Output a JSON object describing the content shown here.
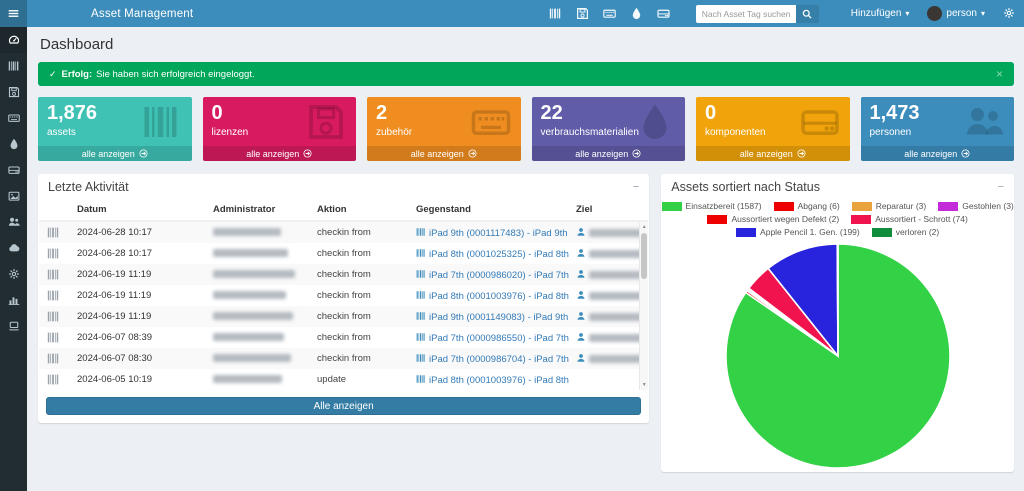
{
  "navbar": {
    "title": "Asset Management",
    "search_placeholder": "Nach Asset Tag suchen",
    "add_label": "Hinzufügen",
    "user_label": "person",
    "color": "#3c8dbc",
    "shortcut_icons": [
      "barcode-icon",
      "floppy-icon",
      "keyboard-icon",
      "droplet-icon",
      "hdd-icon"
    ]
  },
  "sidebar": {
    "color": "#222d32",
    "items": [
      {
        "name": "dashboard",
        "icon": "tachometer-icon",
        "active": true
      },
      {
        "name": "assets",
        "icon": "barcode-icon",
        "active": false
      },
      {
        "name": "licenses",
        "icon": "floppy-icon",
        "active": false
      },
      {
        "name": "accessories",
        "icon": "keyboard-icon",
        "active": false
      },
      {
        "name": "consumables",
        "icon": "droplet-icon",
        "active": false
      },
      {
        "name": "components",
        "icon": "hdd-icon",
        "active": false
      },
      {
        "name": "kits",
        "icon": "image-icon",
        "active": false
      },
      {
        "name": "people",
        "icon": "users-icon",
        "active": false
      },
      {
        "name": "import",
        "icon": "cloud-icon",
        "active": false
      },
      {
        "name": "settings",
        "icon": "gear-icon",
        "active": false
      },
      {
        "name": "reports",
        "icon": "bar-chart-icon",
        "active": false
      },
      {
        "name": "requestable",
        "icon": "laptop-icon",
        "active": false
      }
    ]
  },
  "page": {
    "title": "Dashboard"
  },
  "alert": {
    "prefix": "Erfolg:",
    "message": "Sie haben sich erfolgreich eingeloggt.",
    "color": "#00a65a"
  },
  "cards": [
    {
      "count": "1,876",
      "label": "assets",
      "color": "#3fc1b4",
      "icon": "barcode-icon",
      "link_label": "alle anzeigen"
    },
    {
      "count": "0",
      "label": "lizenzen",
      "color": "#d81b60",
      "icon": "floppy-icon",
      "link_label": "alle anzeigen"
    },
    {
      "count": "2",
      "label": "zubehör",
      "color": "#ef8d20",
      "icon": "keyboard-icon",
      "link_label": "alle anzeigen"
    },
    {
      "count": "22",
      "label": "verbrauchsmaterialien",
      "color": "#605ca8",
      "icon": "droplet-icon",
      "link_label": "alle anzeigen"
    },
    {
      "count": "0",
      "label": "komponenten",
      "color": "#f0a30a",
      "icon": "hdd-icon",
      "link_label": "alle anzeigen"
    },
    {
      "count": "1,473",
      "label": "personen",
      "color": "#3c8dbc",
      "icon": "users-icon",
      "link_label": "alle anzeigen"
    }
  ],
  "activity": {
    "title": "Letzte Aktivität",
    "columns": [
      "Datum",
      "Administrator",
      "Aktion",
      "Gegenstand",
      "Ziel"
    ],
    "rows": [
      {
        "date": "2024-06-28 10:17",
        "action": "checkin from",
        "item": "iPad 9th (0001117483) - iPad 9th",
        "admin_redacted": true,
        "has_target": true
      },
      {
        "date": "2024-06-28 10:17",
        "action": "checkin from",
        "item": "iPad 8th (0001025325) - iPad 8th",
        "admin_redacted": true,
        "has_target": true
      },
      {
        "date": "2024-06-19 11:19",
        "action": "checkin from",
        "item": "iPad 7th (0000986020) - iPad 7th",
        "admin_redacted": true,
        "has_target": true
      },
      {
        "date": "2024-06-19 11:19",
        "action": "checkin from",
        "item": "iPad 8th (0001003976) - iPad 8th",
        "admin_redacted": true,
        "has_target": true
      },
      {
        "date": "2024-06-19 11:19",
        "action": "checkin from",
        "item": "iPad 9th (0001149083) - iPad 9th",
        "admin_redacted": true,
        "has_target": true
      },
      {
        "date": "2024-06-07 08:39",
        "action": "checkin from",
        "item": "iPad 7th (0000986550) - iPad 7th",
        "admin_redacted": true,
        "has_target": true
      },
      {
        "date": "2024-06-07 08:30",
        "action": "checkin from",
        "item": "iPad 7th (0000986704) - iPad 7th",
        "admin_redacted": true,
        "has_target": true
      },
      {
        "date": "2024-06-05 10:19",
        "action": "update",
        "item": "iPad 8th (0001003976) - iPad 8th",
        "admin_redacted": true,
        "has_target": false
      }
    ],
    "view_all_label": "Alle anzeigen"
  },
  "status_panel": {
    "title": "Assets sortiert nach Status"
  },
  "chart_data": {
    "type": "pie",
    "title": "Assets sortiert nach Status",
    "labels": [
      "Einsatzbereit (1587)",
      "Abgang (6)",
      "Reparatur (3)",
      "Gestohlen (3)",
      "Aussortiert wegen Defekt (2)",
      "Aussortiert - Schrott (74)",
      "Apple Pencil 1. Gen. (199)",
      "verloren (2)"
    ],
    "values": [
      1587,
      6,
      3,
      3,
      2,
      74,
      199,
      2
    ],
    "colors": [
      "#33d146",
      "#ee0000",
      "#e8a33d",
      "#c32ad8",
      "#ee0000",
      "#f0134d",
      "#2824dd",
      "#0f8c3c"
    ],
    "legend_position": "top",
    "legend_rows": [
      [
        0,
        1,
        2,
        3
      ],
      [
        4,
        5
      ],
      [
        6,
        7
      ]
    ],
    "start_angle_deg": -90,
    "direction": "clockwise"
  }
}
